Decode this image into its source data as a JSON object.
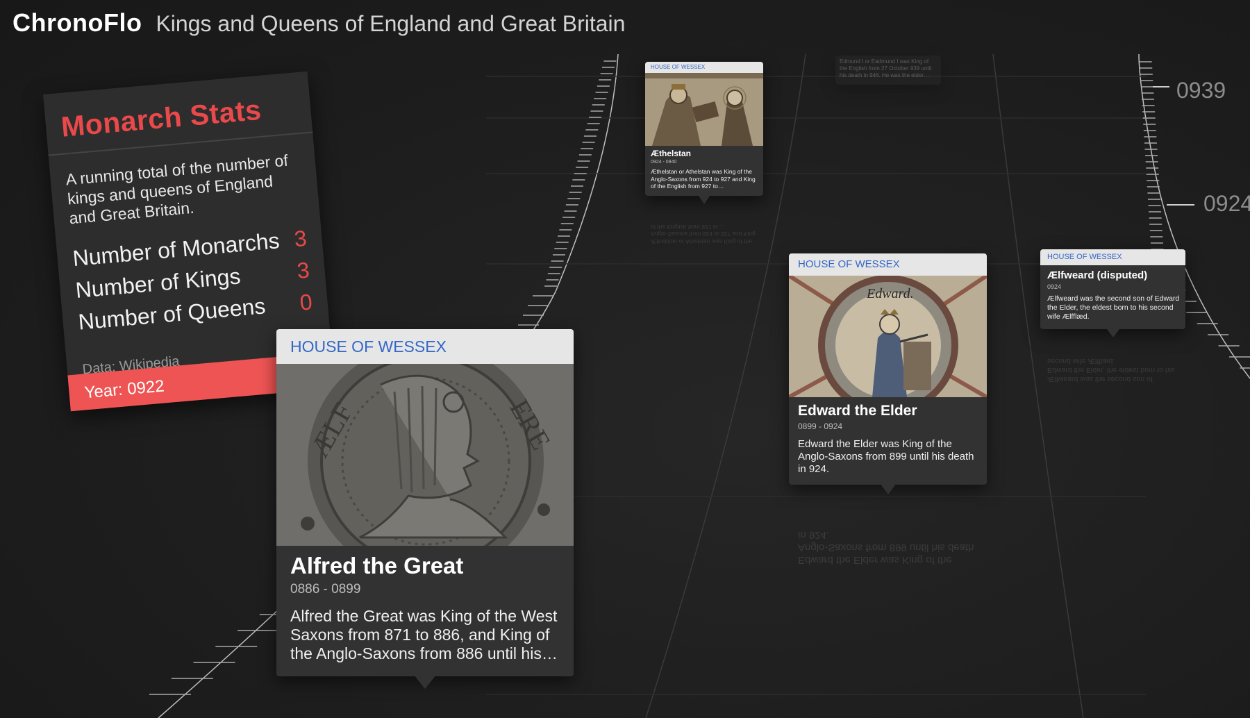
{
  "header": {
    "app_title": "ChronoFlo",
    "page_title": "Kings and Queens of England and Great Britain"
  },
  "timeline": {
    "year_labels": [
      "0939",
      "0924"
    ]
  },
  "stats": {
    "title": "Monarch Stats",
    "description": "A running total of the number of kings and queens of England and Great Britain.",
    "rows": [
      {
        "label": "Number of Monarchs",
        "value": "3"
      },
      {
        "label": "Number of Kings",
        "value": "3"
      },
      {
        "label": "Number of Queens",
        "value": "0"
      }
    ],
    "source": "Data: Wikipedia",
    "year": "Year: 0922"
  },
  "cards": {
    "alfred": {
      "house": "HOUSE OF WESSEX",
      "name": "Alfred the Great",
      "dates": "0886 - 0899",
      "description": "Alfred the Great was King of the West Saxons from 871 to 886, and King of the Anglo-Saxons from 886 until his…",
      "image_icon": "silver-coin-portrait"
    },
    "edward": {
      "house": "HOUSE OF WESSEX",
      "name": "Edward the Elder",
      "dates": "0899 - 0924",
      "description": "Edward the Elder was King of the Anglo-Saxons from 899 until his death in 924.",
      "image_icon": "enthroned-king-roundel"
    },
    "aelfweard": {
      "house": "HOUSE OF WESSEX",
      "name": "Ælfweard (disputed)",
      "dates": "0924",
      "description": "Ælfweard was the second son of Edward the Elder, the eldest born to his second wife Ælfflæd."
    },
    "aethelstan": {
      "house": "HOUSE OF WESSEX",
      "name": "Æthelstan",
      "dates": "0924 - 0940",
      "description": "Æthelstan or Athelstan was King of the Anglo-Saxons from 924 to 927 and King of the English from 927 to…",
      "image_icon": "manuscript-king-presenting-book"
    },
    "edmund": {
      "description": "Edmund I or Eadmund I was King of the English from 27 October 939 until his death in 946. He was the elder…"
    }
  },
  "colors": {
    "accent": "#e9494a",
    "year_bar": "#ef5454",
    "house_text": "#3466c8",
    "background": "#1d1d1d"
  }
}
